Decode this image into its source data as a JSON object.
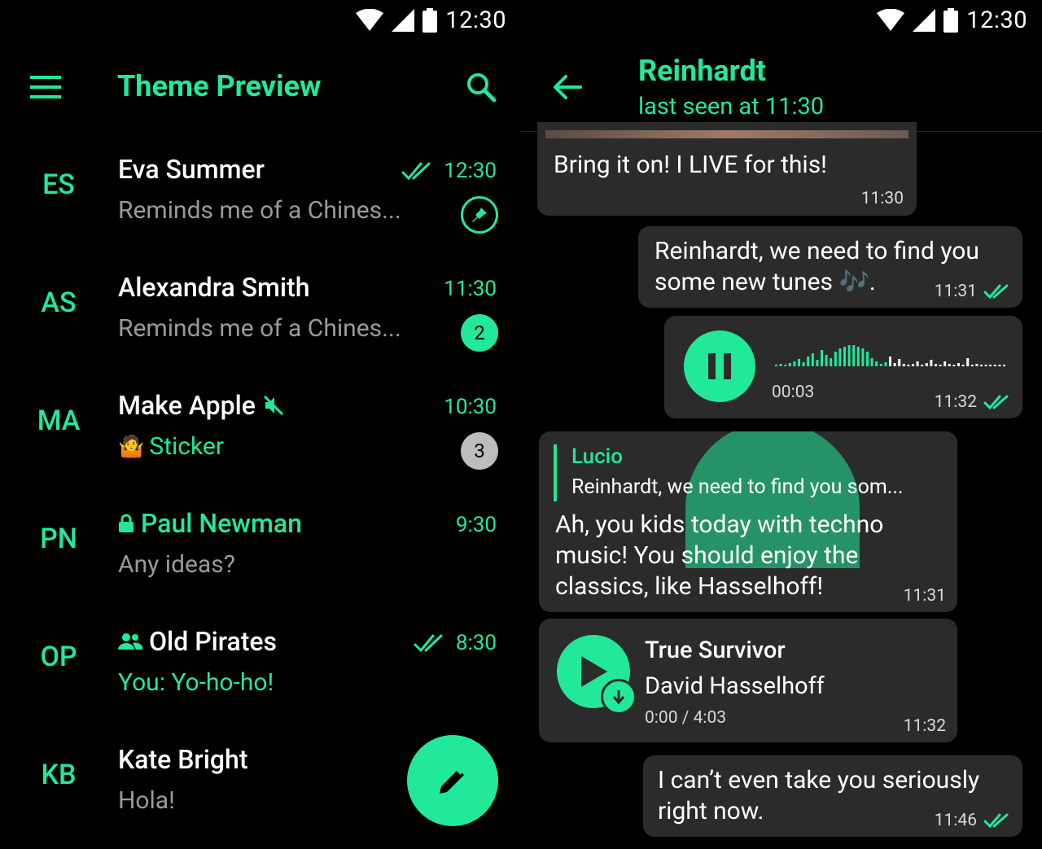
{
  "status_bar": {
    "time": "12:30"
  },
  "chat_list": {
    "title": "Theme Preview",
    "rows": [
      {
        "initials": "ES",
        "name": "Eva Summer",
        "time": "12:30",
        "preview": "Reminds me of a Chines..."
      },
      {
        "initials": "AS",
        "name": "Alexandra Smith",
        "time": "11:30",
        "preview": "Reminds me of a Chines...",
        "badge": "2"
      },
      {
        "initials": "MA",
        "name": "Make Apple",
        "time": "10:30",
        "preview": "Sticker",
        "badge": "3"
      },
      {
        "initials": "PN",
        "name": "Paul Newman",
        "time": "9:30",
        "preview": "Any ideas?"
      },
      {
        "initials": "OP",
        "name": "Old Pirates",
        "time": "8:30",
        "preview_prefix": "You:",
        "preview": "Yo-ho-ho!"
      },
      {
        "initials": "KB",
        "name": "Kate Bright",
        "preview": "Hola!"
      }
    ]
  },
  "chat": {
    "contact_name": "Reinhardt",
    "status": "last seen at 11:30",
    "messages": [
      {
        "text": "Bring it on! I LIVE for this!",
        "time": "11:30"
      },
      {
        "text_line1": "Reinhardt, we need to find you",
        "text_line2": "some new tunes 🎶.",
        "time": "11:31"
      },
      {
        "duration": "00:03",
        "time": "11:32"
      },
      {
        "reply_author": "Lucio",
        "reply_text": "Reinhardt, we need to find you som...",
        "text_line1": "Ah, you kids today with techno",
        "text_line2": "music! You should enjoy the",
        "text_line3": "classics, like Hasselhoff!",
        "time": "11:31"
      },
      {
        "track_title": "True Survivor",
        "track_artist": "David Hasselhoff",
        "progress": "0:00 / 4:03",
        "time": "11:32"
      },
      {
        "text_line1": "I can’t even take you seriously",
        "text_line2": "right now.",
        "time": "11:46"
      }
    ]
  },
  "colors": {
    "accent": "#22e89a",
    "background": "#000000",
    "bubble": "#2b2b2b",
    "muted_badge": "#bdbdbd"
  }
}
